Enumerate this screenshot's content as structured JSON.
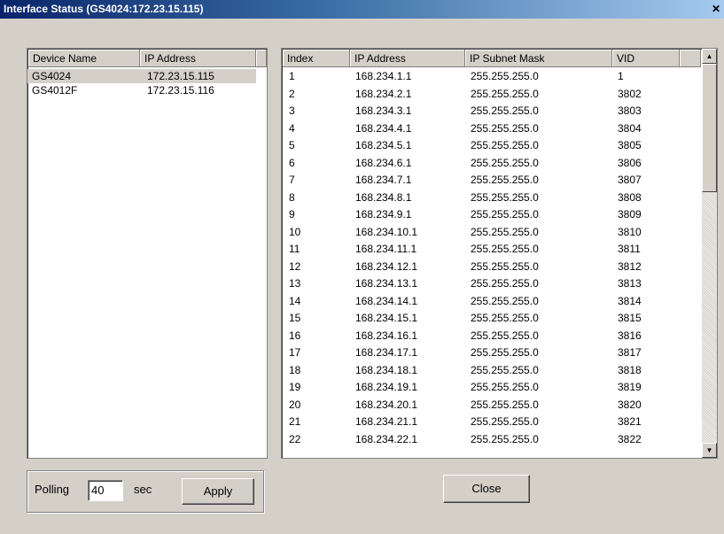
{
  "window": {
    "title": "Interface Status (GS4024:172.23.15.115)",
    "close_glyph": "✕"
  },
  "devices": {
    "headers": [
      "Device Name",
      "IP Address"
    ],
    "rows": [
      {
        "name": "GS4024",
        "ip": "172.23.15.115"
      },
      {
        "name": "GS4012F",
        "ip": "172.23.15.116"
      }
    ]
  },
  "interfaces": {
    "headers": [
      "Index",
      "IP Address",
      "IP Subnet Mask",
      "VID"
    ],
    "rows": [
      {
        "index": "1",
        "ip": "168.234.1.1",
        "mask": "255.255.255.0",
        "vid": "1"
      },
      {
        "index": "2",
        "ip": "168.234.2.1",
        "mask": "255.255.255.0",
        "vid": "3802"
      },
      {
        "index": "3",
        "ip": "168.234.3.1",
        "mask": "255.255.255.0",
        "vid": "3803"
      },
      {
        "index": "4",
        "ip": "168.234.4.1",
        "mask": "255.255.255.0",
        "vid": "3804"
      },
      {
        "index": "5",
        "ip": "168.234.5.1",
        "mask": "255.255.255.0",
        "vid": "3805"
      },
      {
        "index": "6",
        "ip": "168.234.6.1",
        "mask": "255.255.255.0",
        "vid": "3806"
      },
      {
        "index": "7",
        "ip": "168.234.7.1",
        "mask": "255.255.255.0",
        "vid": "3807"
      },
      {
        "index": "8",
        "ip": "168.234.8.1",
        "mask": "255.255.255.0",
        "vid": "3808"
      },
      {
        "index": "9",
        "ip": "168.234.9.1",
        "mask": "255.255.255.0",
        "vid": "3809"
      },
      {
        "index": "10",
        "ip": "168.234.10.1",
        "mask": "255.255.255.0",
        "vid": "3810"
      },
      {
        "index": "11",
        "ip": "168.234.11.1",
        "mask": "255.255.255.0",
        "vid": "3811"
      },
      {
        "index": "12",
        "ip": "168.234.12.1",
        "mask": "255.255.255.0",
        "vid": "3812"
      },
      {
        "index": "13",
        "ip": "168.234.13.1",
        "mask": "255.255.255.0",
        "vid": "3813"
      },
      {
        "index": "14",
        "ip": "168.234.14.1",
        "mask": "255.255.255.0",
        "vid": "3814"
      },
      {
        "index": "15",
        "ip": "168.234.15.1",
        "mask": "255.255.255.0",
        "vid": "3815"
      },
      {
        "index": "16",
        "ip": "168.234.16.1",
        "mask": "255.255.255.0",
        "vid": "3816"
      },
      {
        "index": "17",
        "ip": "168.234.17.1",
        "mask": "255.255.255.0",
        "vid": "3817"
      },
      {
        "index": "18",
        "ip": "168.234.18.1",
        "mask": "255.255.255.0",
        "vid": "3818"
      },
      {
        "index": "19",
        "ip": "168.234.19.1",
        "mask": "255.255.255.0",
        "vid": "3819"
      },
      {
        "index": "20",
        "ip": "168.234.20.1",
        "mask": "255.255.255.0",
        "vid": "3820"
      },
      {
        "index": "21",
        "ip": "168.234.21.1",
        "mask": "255.255.255.0",
        "vid": "3821"
      },
      {
        "index": "22",
        "ip": "168.234.22.1",
        "mask": "255.255.255.0",
        "vid": "3822"
      }
    ]
  },
  "polling": {
    "label": "Polling",
    "value": "40",
    "unit": "sec",
    "apply_label": "Apply"
  },
  "close_label": "Close"
}
